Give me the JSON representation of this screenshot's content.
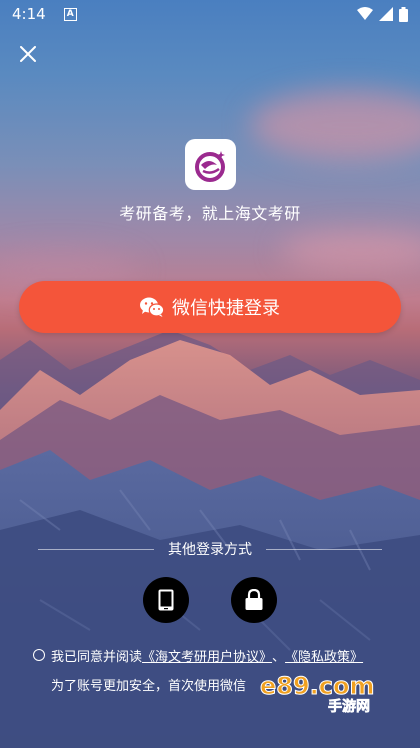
{
  "status_bar": {
    "time": "4:14",
    "notification_icon_letter": "A",
    "icons": [
      "wifi-icon",
      "signal-icon",
      "battery-icon"
    ]
  },
  "header": {
    "close_icon": "close-icon",
    "logo_icon": "app-logo-icon",
    "tagline": "考研备考，就上海文考研"
  },
  "login": {
    "wechat_button_label": "微信快捷登录",
    "wechat_icon": "wechat-icon"
  },
  "other_methods": {
    "label": "其他登录方式",
    "buttons": [
      {
        "name": "phone-login",
        "icon": "phone-icon"
      },
      {
        "name": "password-login",
        "icon": "lock-icon"
      }
    ]
  },
  "agreement": {
    "prefix": "我已同意并阅读",
    "user_agreement": "《海文考研用户协议》",
    "separator": "、",
    "privacy_policy": "《隐私政策》",
    "note": "为了账号更加安全，首次使用微信"
  },
  "watermark": {
    "logo_text": "e89.com",
    "sub_text": "手游网"
  },
  "colors": {
    "accent": "#f4553a",
    "logo_purple": "#9b2a8f"
  }
}
